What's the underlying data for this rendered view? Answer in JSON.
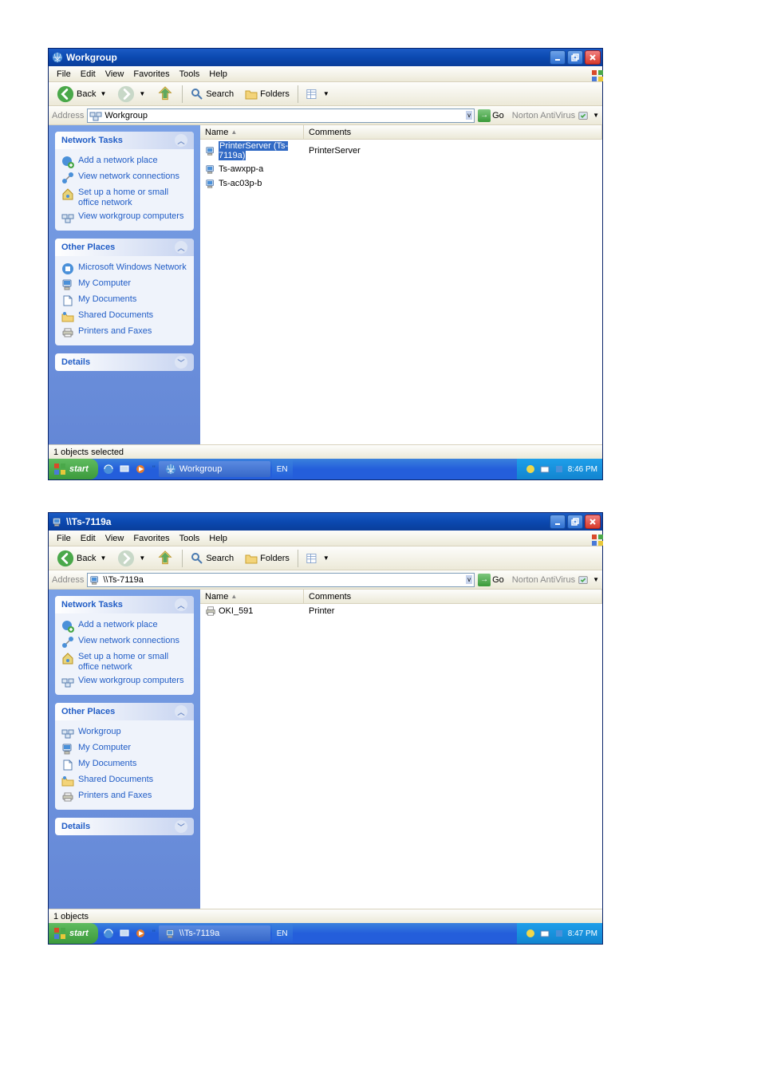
{
  "screenshots": [
    {
      "title": "Workgroup",
      "address": "Workgroup",
      "columns": {
        "name": "Name",
        "comments": "Comments"
      },
      "items": [
        {
          "name": "PrinterServer (Ts-7119a)",
          "comment": "PrinterServer",
          "selected": true,
          "icon": "computer"
        },
        {
          "name": "Ts-awxpp-a",
          "comment": "",
          "selected": false,
          "icon": "computer"
        },
        {
          "name": "Ts-ac03p-b",
          "comment": "",
          "selected": false,
          "icon": "computer"
        }
      ],
      "status": "1 objects selected",
      "network_tasks": {
        "title": "Network Tasks",
        "items": [
          "Add a network place",
          "View network connections",
          "Set up a home or small office network",
          "View workgroup computers"
        ]
      },
      "other_places": {
        "title": "Other Places",
        "items": [
          "Microsoft Windows Network",
          "My Computer",
          "My Documents",
          "Shared Documents",
          "Printers and Faxes"
        ]
      },
      "details": {
        "title": "Details"
      },
      "taskbar": {
        "app": "Workgroup",
        "lang": "EN",
        "time": "8:46 PM"
      }
    },
    {
      "title": "\\\\Ts-7119a",
      "address": "\\\\Ts-7119a",
      "columns": {
        "name": "Name",
        "comments": "Comments"
      },
      "items": [
        {
          "name": "OKI_591",
          "comment": "Printer",
          "selected": false,
          "icon": "printer"
        }
      ],
      "status": "1 objects",
      "network_tasks": {
        "title": "Network Tasks",
        "items": [
          "Add a network place",
          "View network connections",
          "Set up a home or small office network",
          "View workgroup computers"
        ]
      },
      "other_places": {
        "title": "Other Places",
        "items": [
          "Workgroup",
          "My Computer",
          "My Documents",
          "Shared Documents",
          "Printers and Faxes"
        ]
      },
      "details": {
        "title": "Details"
      },
      "taskbar": {
        "app": "\\\\Ts-7119a",
        "lang": "EN",
        "time": "8:47 PM"
      }
    }
  ],
  "menu": {
    "file": "File",
    "edit": "Edit",
    "view": "View",
    "favorites": "Favorites",
    "tools": "Tools",
    "help": "Help"
  },
  "toolbar": {
    "back": "Back",
    "search": "Search",
    "folders": "Folders"
  },
  "addressbar": {
    "label": "Address",
    "go": "Go",
    "av": "Norton AntiVirus"
  },
  "start": {
    "label": "start"
  }
}
